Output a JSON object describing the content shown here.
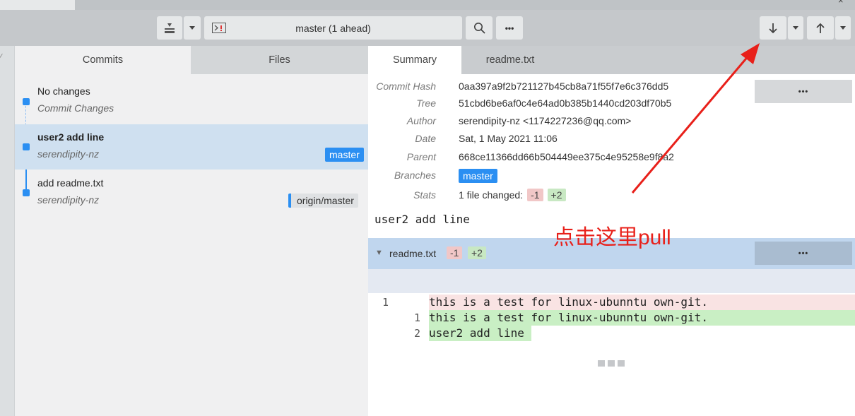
{
  "toolbar": {
    "branch_label": "master (1 ahead)",
    "more_label": "•••"
  },
  "left_tabs": {
    "commits": "Commits",
    "files": "Files"
  },
  "commits": [
    {
      "title": "No changes",
      "author": "Commit Changes"
    },
    {
      "title": "user2 add line",
      "author": "serendipity-nz",
      "badge": "master"
    },
    {
      "title": "add readme.txt",
      "author": "serendipity-nz",
      "badge": "origin/master"
    }
  ],
  "right_tabs": {
    "summary": "Summary",
    "readme": "readme.txt"
  },
  "details": {
    "commit_hash_label": "Commit Hash",
    "commit_hash": "0aa397a9f2b721127b45cb8a71f55f7e6c376dd5",
    "tree_label": "Tree",
    "tree": "51cbd6be6af0c4e64ad0b385b1440cd203df70b5",
    "author_label": "Author",
    "author": "serendipity-nz <1174227236@qq.com>",
    "date_label": "Date",
    "date": "Sat, 1 May 2021 11:06",
    "parent_label": "Parent",
    "parent": "668ce11366dd66b504449ee375c4e95258e9f8a2",
    "branches_label": "Branches",
    "branch": "master",
    "stats_label": "Stats",
    "stats_text": "1 file changed:",
    "stats_minus": "-1",
    "stats_plus": "+2",
    "more_label": "•••"
  },
  "commit_message": "user2 add line",
  "file_diff": {
    "file_name": "readme.txt",
    "minus": "-1",
    "plus": "+2",
    "more_label": "•••",
    "lines": [
      {
        "old": "1",
        "new": "",
        "text": "this is a test for linux-ubunntu own-git.",
        "kind": "removed"
      },
      {
        "old": "",
        "new": "1",
        "text": "this is a test for linux-ubunntu own-git.",
        "kind": "added"
      },
      {
        "old": "",
        "new": "2",
        "text": "user2 add line",
        "kind": "added"
      }
    ]
  },
  "annotation": "点击这里pull",
  "colors": {
    "accent": "#2b8ff2",
    "annotation": "#e8201a",
    "removed": "#f9e3e3",
    "added": "#c9efc4"
  }
}
